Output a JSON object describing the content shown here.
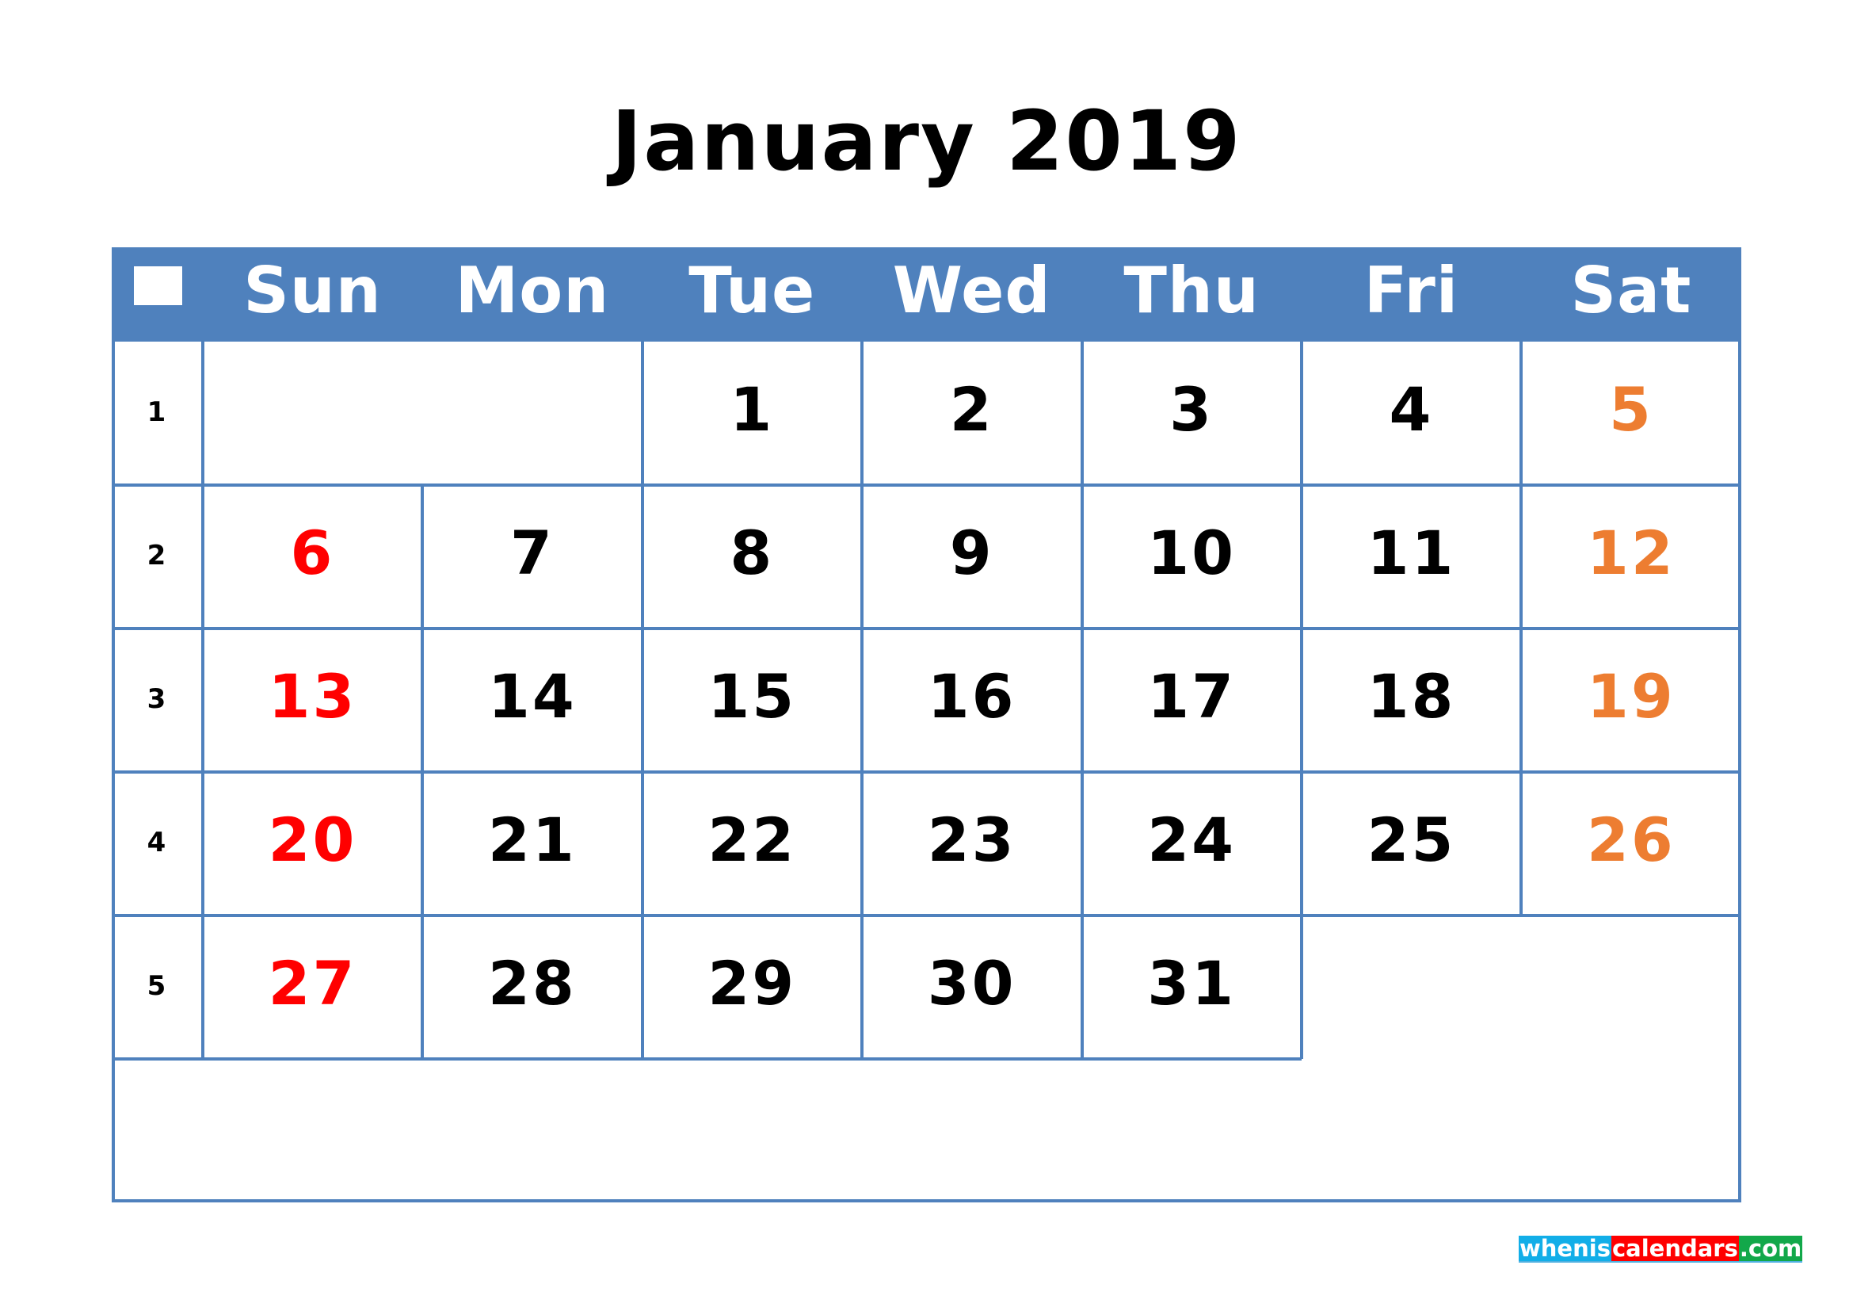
{
  "title": "January 2019",
  "calendar": {
    "header_icon": "white-square-icon",
    "weekdays": [
      "Sun",
      "Mon",
      "Tue",
      "Wed",
      "Thu",
      "Fri",
      "Sat"
    ],
    "week_numbers": [
      "1",
      "2",
      "3",
      "4",
      "5"
    ],
    "weeks": [
      [
        "",
        "",
        "1",
        "2",
        "3",
        "4",
        "5"
      ],
      [
        "6",
        "7",
        "8",
        "9",
        "10",
        "11",
        "12"
      ],
      [
        "13",
        "14",
        "15",
        "16",
        "17",
        "18",
        "19"
      ],
      [
        "20",
        "21",
        "22",
        "23",
        "24",
        "25",
        "26"
      ],
      [
        "27",
        "28",
        "29",
        "30",
        "31",
        "",
        ""
      ]
    ],
    "colors": {
      "header": "#4f81bd",
      "grid": "#4f81bd",
      "sunday": "#ff0000",
      "saturday": "#ed7d31",
      "weekday": "#000000"
    }
  },
  "watermark": {
    "parts": [
      {
        "text": "whenis",
        "color": "#12aee8"
      },
      {
        "text": "calendars",
        "color": "#ff0000"
      },
      {
        "text": ".com",
        "color": "#12a84a"
      }
    ]
  }
}
